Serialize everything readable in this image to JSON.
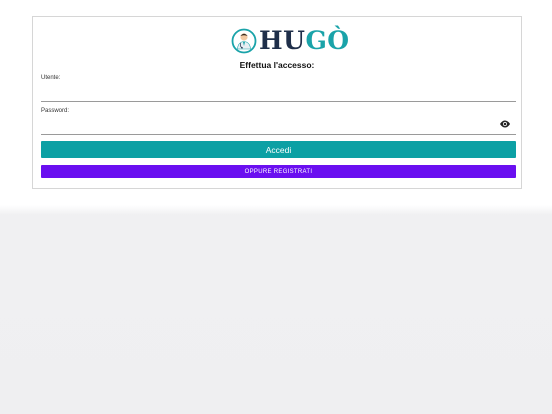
{
  "brand": {
    "part1": "HU",
    "part2": "GÒ"
  },
  "login": {
    "title": "Effettua l'accesso:",
    "username_label": "Utente:",
    "username_value": "",
    "password_label": "Password:",
    "password_value": "",
    "submit_label": "Accedi",
    "register_label": "OPPURE REGISTRATI"
  },
  "colors": {
    "accent": "#0ca0a4",
    "register": "#6a0ff0",
    "logo_dark": "#1f2f4a",
    "logo_teal": "#1aa3a9"
  },
  "icons": {
    "logo": "doctor-avatar-icon",
    "password_toggle": "eye-icon"
  }
}
